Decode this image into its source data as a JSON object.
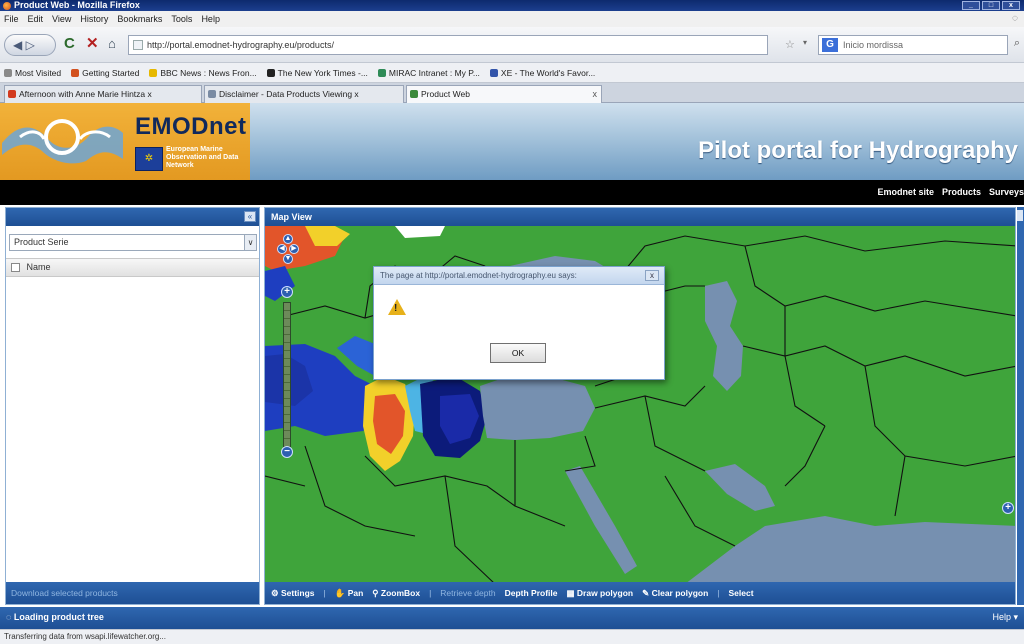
{
  "window": {
    "title": "Product Web - Mozilla Firefox"
  },
  "menu": [
    "File",
    "Edit",
    "View",
    "History",
    "Bookmarks",
    "Tools",
    "Help"
  ],
  "navbar": {
    "url": "http://portal.emodnet-hydrography.eu/products/",
    "search_placeholder": "Inicio mordissa"
  },
  "bookmarks": [
    {
      "label": "Most Visited",
      "color": "#8a8a8a"
    },
    {
      "label": "Getting Started",
      "color": "#d2511f"
    },
    {
      "label": "BBC News : News Fron...",
      "color": "#e6b800"
    },
    {
      "label": "The New York Times -...",
      "color": "#222222"
    },
    {
      "label": "MIRAC Intranet : My P...",
      "color": "#2e8b57"
    },
    {
      "label": "XE - The World's Favor...",
      "color": "#3355aa"
    }
  ],
  "tabs": [
    {
      "label": "Afternoon with Anne Marie Hintza x",
      "color": "#d23a1f"
    },
    {
      "label": "Disclaimer - Data Products Viewing x",
      "color": "#7a8ba3"
    },
    {
      "label": "Product Web",
      "color": "#3b8a3b"
    }
  ],
  "banner": {
    "logo_text": "EMODnet",
    "subtitle": "European Marine Observation and Data Network",
    "portal_title": "Pilot portal for Hydrography"
  },
  "site_nav": [
    "Emodnet site",
    "Products",
    "Surveys"
  ],
  "left_panel": {
    "select_value": "Product Serie",
    "column_name": "Name",
    "footer": "Download selected products"
  },
  "map": {
    "header": "Map View",
    "colors": {
      "land": "#3fa43b",
      "sea": "#7690b0",
      "deep": "#0c1b7a"
    }
  },
  "toolbar": {
    "settings": "Settings",
    "pan": "Pan",
    "zoombox": "ZoomBox",
    "retrieve_depth": "Retrieve depth",
    "depth_profile": "Depth Profile",
    "draw_polygon": "Draw polygon",
    "clear_polygon": "Clear polygon",
    "select": "Select"
  },
  "dialog": {
    "title": "The page at http://portal.emodnet-hydrography.eu says:",
    "ok": "OK"
  },
  "status": {
    "loading": "Loading product tree",
    "help": "Help",
    "browser_status": "Transferring data from wsapi.lifewatcher.org..."
  }
}
